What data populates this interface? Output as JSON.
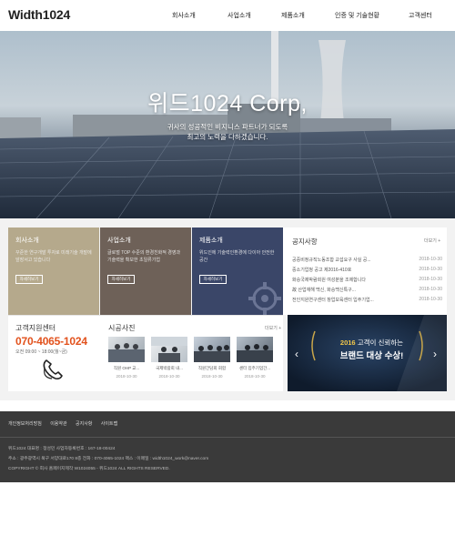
{
  "header": {
    "logo": "Width1024",
    "nav": [
      "회사소개",
      "사업소개",
      "제품소개",
      "인증 및 기술현황",
      "고객센터"
    ]
  },
  "hero": {
    "title": "위드1024 Corp,",
    "subtitle_line1": "귀사의 성공적인 비지니스 파트너가 되도록",
    "subtitle_line2": "최고의 노력을 다하겠습니다."
  },
  "cards": [
    {
      "title": "회사소개",
      "desc": "꾸준한 연구개발 투자로 미래기술 개발에 앞장서고 있습니다",
      "button": "자세히보기",
      "color": "#b5a98c"
    },
    {
      "title": "사업소개",
      "desc": "글로벌 TOP 수준의 환경친화적 경영과 기술력을 확보한 초일류기업",
      "button": "자세히보기",
      "color": "#6e6158"
    },
    {
      "title": "제품소개",
      "desc": "위드인에 기술력인환경에 다이아 안전한 공간",
      "button": "자세히보기",
      "color": "#3a4668"
    }
  ],
  "notice": {
    "title": "공지사항",
    "more": "더보기 +",
    "items": [
      {
        "title": "공중비정규직노동조합 교섭요구 사실 공...",
        "date": "2018-10-30"
      },
      {
        "title": "중소기업청 공고 제2016-410호",
        "date": "2018-10-30"
      },
      {
        "title": "화승국제박람회원 여성분을 조제합니다",
        "date": "2018-10-30"
      },
      {
        "title": "故 산업재해 백신, 화승백신특구...",
        "date": "2018-10-30"
      },
      {
        "title": "전인지원연구센터 창업보육센터 입주기업...",
        "date": "2018-10-30"
      }
    ]
  },
  "support": {
    "title": "고객지원센터",
    "phone": "070-4065-1024",
    "hours": "오전 09:00 ~ 18:00(월~금)"
  },
  "gallery": {
    "title": "시공사진",
    "more": "더보기 +",
    "items": [
      {
        "caption": "직원 OHP 교...",
        "date": "2018-10-30"
      },
      {
        "caption": "국제박람회 내...",
        "date": "2018-10-30"
      },
      {
        "caption": "직원간담회 회합",
        "date": "2018-10-30"
      },
      {
        "caption": "센터 입주기업간...",
        "date": "2018-10-30"
      }
    ]
  },
  "banner": {
    "year": "2016",
    "line1": "고객이 신뢰하는",
    "line2": "브랜드 대상 수상!"
  },
  "footer": {
    "links": [
      "개인정보처리방침",
      "이용약관",
      "공지사항",
      "사이트맵"
    ],
    "line1": "위드1024   대표명 : 정성민   사업자등록번호 : 167-18-00424",
    "line2": "주소 : 광주광역시 북구 서양대로170 8층   전화 : 070-4065-1024   팩스 :   이메일 : width1024_work@naver.com",
    "line3": "COPYRIGHT © 회사 홈페이지제작 W1024055 - 위드1024 ALL RIGHTS RESERVED."
  },
  "colors": {
    "accent_phone": "#e2521d",
    "banner_bg": "#15263d",
    "footer_bg": "#3a3a3a"
  }
}
